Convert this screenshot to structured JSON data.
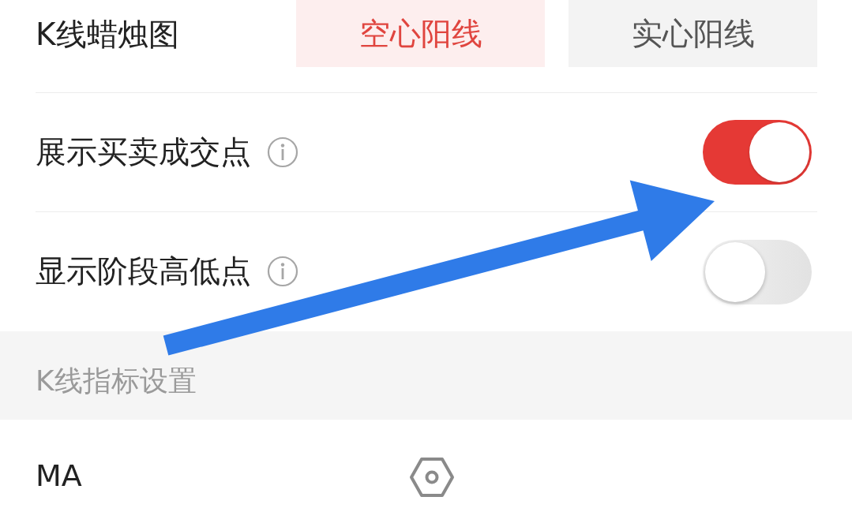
{
  "candlestick": {
    "label": "K线蜡烛图",
    "options": [
      {
        "label": "空心阳线",
        "selected": true
      },
      {
        "label": "实心阳线",
        "selected": false
      }
    ]
  },
  "toggles": [
    {
      "label": "展示买卖成交点",
      "on": true
    },
    {
      "label": "显示阶段高低点",
      "on": false
    }
  ],
  "section": {
    "title": "K线指标设置"
  },
  "indicators": [
    {
      "name": "MA"
    }
  ]
}
